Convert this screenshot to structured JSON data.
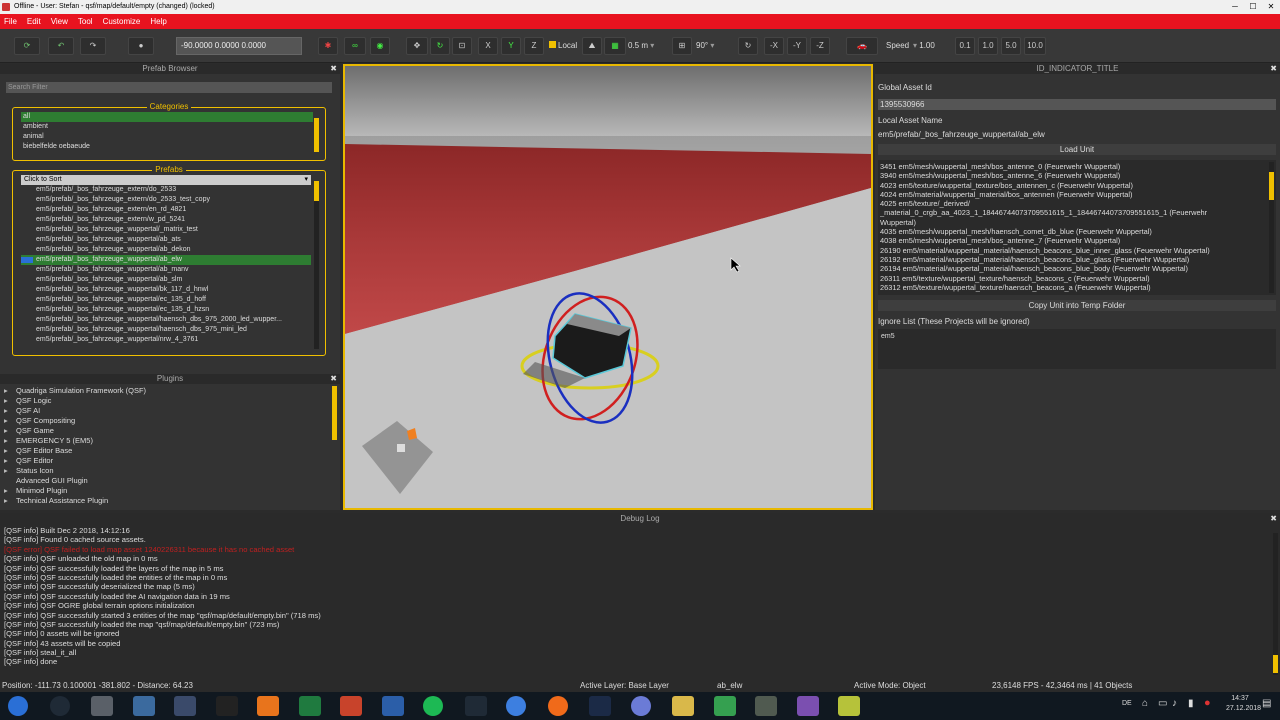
{
  "window": {
    "title": "Offline - User: Stefan - qsf/map/default/empty (changed) (locked)",
    "controls": [
      "─",
      "☐",
      "✕"
    ]
  },
  "menu": [
    "File",
    "Edit",
    "View",
    "Tool",
    "Customize",
    "Help"
  ],
  "toolbar": {
    "position_value": "-90.0000 0.0000 0.0000",
    "axis_x": "X",
    "axis_y": "Y",
    "axis_z": "Z",
    "local_label": "Local",
    "grid_size": "0.5 m",
    "rotation_step": "90°",
    "neg_x": "-X",
    "neg_y": "-Y",
    "neg_z": "-Z",
    "speed_label": "Speed",
    "speed_value": "1.00",
    "speed_presets": [
      "0.1",
      "1.0",
      "5.0",
      "10.0"
    ]
  },
  "prefab_browser": {
    "title": "Prefab Browser",
    "search_placeholder": "Search Filter",
    "categories_title": "Categories",
    "categories": [
      "all",
      "ambient",
      "animal",
      "biebelfelde oebaeude"
    ],
    "selected_category": 0,
    "prefabs_title": "Prefabs",
    "sort_label": "Click to Sort",
    "prefabs": [
      "em5/prefab/_bos_fahrzeuge_extern/do_2533",
      "em5/prefab/_bos_fahrzeuge_extern/do_2533_test_copy",
      "em5/prefab/_bos_fahrzeuge_extern/en_rd_4821",
      "em5/prefab/_bos_fahrzeuge_extern/w_pd_5241",
      "em5/prefab/_bos_fahrzeuge_wuppertal/_matrix_test",
      "em5/prefab/_bos_fahrzeuge_wuppertal/ab_ats",
      "em5/prefab/_bos_fahrzeuge_wuppertal/ab_dekon",
      "em5/prefab/_bos_fahrzeuge_wuppertal/ab_elw",
      "em5/prefab/_bos_fahrzeuge_wuppertal/ab_manv",
      "em5/prefab/_bos_fahrzeuge_wuppertal/ab_slm",
      "em5/prefab/_bos_fahrzeuge_wuppertal/bk_117_d_hnwl",
      "em5/prefab/_bos_fahrzeuge_wuppertal/ec_135_d_hoff",
      "em5/prefab/_bos_fahrzeuge_wuppertal/ec_135_d_hzsn",
      "em5/prefab/_bos_fahrzeuge_wuppertal/haensch_dbs_975_2000_led_wupper...",
      "em5/prefab/_bos_fahrzeuge_wuppertal/haensch_dbs_975_mini_led",
      "em5/prefab/_bos_fahrzeuge_wuppertal/nrw_4_3761"
    ],
    "selected_prefab": 7
  },
  "plugins": {
    "title": "Plugins",
    "items": [
      {
        "label": "Quadriga Simulation Framework (QSF)",
        "expandable": true
      },
      {
        "label": "QSF Logic",
        "expandable": true
      },
      {
        "label": "QSF AI",
        "expandable": true
      },
      {
        "label": "QSF Compositing",
        "expandable": true
      },
      {
        "label": "QSF Game",
        "expandable": true
      },
      {
        "label": "EMERGENCY 5 (EM5)",
        "expandable": true
      },
      {
        "label": "QSF Editor Base",
        "expandable": true
      },
      {
        "label": "QSF Editor",
        "expandable": true
      },
      {
        "label": "Status Icon",
        "expandable": true
      },
      {
        "label": "Advanced GUI Plugin",
        "expandable": false
      },
      {
        "label": "Minimod Plugin",
        "expandable": true
      },
      {
        "label": "Technical Assistance Plugin",
        "expandable": true
      }
    ]
  },
  "indicator_panel": {
    "title": "ID_INDICATOR_TITLE",
    "global_asset_label": "Global Asset Id",
    "global_asset_value": "1395530966",
    "local_asset_label": "Local Asset Name",
    "local_asset_value": "em5/prefab/_bos_fahrzeuge_wuppertal/ab_elw",
    "load_unit_button": "Load Unit",
    "unit_lines": [
      "3451 em5/mesh/wuppertal_mesh/bos_antenne_0 (Feuerwehr Wuppertal)",
      "3940 em5/mesh/wuppertal_mesh/bos_antenne_6 (Feuerwehr Wuppertal)",
      "4023 em5/texture/wuppertal_texture/bos_antennen_c (Feuerwehr Wuppertal)",
      "4024 em5/material/wuppertal_material/bos_antennen (Feuerwehr Wuppertal)",
      "4025 em5/texture/_derived/",
      "_material_0_crgb_aa_4023_1_18446744073709551615_1_18446744073709551615_1 (Feuerwehr",
      "Wuppertal)",
      "4035 em5/mesh/wuppertal_mesh/haensch_comet_db_blue (Feuerwehr Wuppertal)",
      "4038 em5/mesh/wuppertal_mesh/bos_antenne_7 (Feuerwehr Wuppertal)",
      "26190 em5/material/wuppertal_material/haensch_beacons_blue_inner_glass (Feuerwehr Wuppertal)",
      "26192 em5/material/wuppertal_material/haensch_beacons_blue_glass (Feuerwehr Wuppertal)",
      "26194 em5/material/wuppertal_material/haensch_beacons_blue_body (Feuerwehr Wuppertal)",
      "26311 em5/texture/wuppertal_texture/haensch_beacons_c (Feuerwehr Wuppertal)",
      "26312 em5/texture/wuppertal_texture/haensch_beacons_a (Feuerwehr Wuppertal)"
    ],
    "copy_button": "Copy Unit into Temp Folder",
    "ignore_label": "Ignore List (These Projects will be ignored)",
    "ignore_value": "em5"
  },
  "debug_log": {
    "title": "Debug Log",
    "lines": [
      {
        "text": "[QSF info] Built Dec 2 2018, 14:12:16",
        "error": false
      },
      {
        "text": "[QSF info] Found 0 cached source assets.",
        "error": false
      },
      {
        "text": "[QSF error] QSF failed to load map asset 1240226311 because it has no cached asset",
        "error": true
      },
      {
        "text": "[QSF info] QSF unloaded the old map in 0 ms",
        "error": false
      },
      {
        "text": "[QSF info] QSF successfully loaded the layers of the map in 5 ms",
        "error": false
      },
      {
        "text": "[QSF info] QSF successfully loaded the entities of the map in 0 ms",
        "error": false
      },
      {
        "text": "[QSF info] QSF successfully deserialized the map (5 ms)",
        "error": false
      },
      {
        "text": "[QSF info] QSF successfully loaded the AI navigation data in 19 ms",
        "error": false
      },
      {
        "text": "[QSF info] QSF OGRE global terrain options initialization",
        "error": false
      },
      {
        "text": "[QSF info] QSF successfully started 3 entities of the map \"qsf/map/default/empty.bin\" (718 ms)",
        "error": false
      },
      {
        "text": "[QSF info] QSF successfully loaded the map \"qsf/map/default/empty.bin\" (723 ms)",
        "error": false
      },
      {
        "text": "[QSF info] 0 assets will be ignored",
        "error": false
      },
      {
        "text": "[QSF info] 43 assets will be copied",
        "error": false
      },
      {
        "text": "[QSF info] steal_it_all",
        "error": false
      },
      {
        "text": "[QSF info] done",
        "error": false
      }
    ]
  },
  "status": {
    "position": "Position: -111.73 0.100001 -381.802 - Distance: 64.23",
    "active_layer": "Active Layer: Base Layer",
    "selection": "ab_elw",
    "active_mode": "Active Mode: Object",
    "fps": "23,6148 FPS - 42,3464 ms | 41 Objects"
  },
  "taskbar": {
    "lang": "DE",
    "time": "14:37",
    "date": "27.12.2018",
    "apps": [
      "start",
      "cortana",
      "tool",
      "flag",
      "music",
      "terminal",
      "firefox",
      "excel",
      "powerpoint",
      "word",
      "spotify",
      "editor",
      "chrome",
      "origin",
      "steam",
      "discord",
      "explorer",
      "qsf",
      "notepad",
      "vs",
      "notes"
    ],
    "colors": {
      "menu_red": "#e8131f",
      "accent_yellow": "#f0c000",
      "selection_green": "#2e7d32"
    }
  }
}
